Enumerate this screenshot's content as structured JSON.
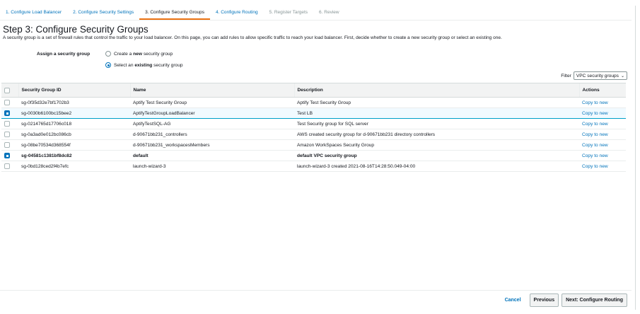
{
  "steps": [
    {
      "label": "1. Configure Load Balancer",
      "state": "link"
    },
    {
      "label": "2. Configure Security Settings",
      "state": "link"
    },
    {
      "label": "3. Configure Security Groups",
      "state": "active"
    },
    {
      "label": "4. Configure Routing",
      "state": "link"
    },
    {
      "label": "5. Register Targets",
      "state": "disabled"
    },
    {
      "label": "6. Review",
      "state": "disabled"
    }
  ],
  "page": {
    "title": "Step 3: Configure Security Groups",
    "description": "A security group is a set of firewall rules that control the traffic to your load balancer. On this page, you can add rules to allow specific traffic to reach your load balancer. First, decide whether to create a new security group or select an existing one."
  },
  "assign": {
    "label": "Assign a security group",
    "option_new": {
      "prefix": "Create a ",
      "bold": "new",
      "suffix": " security group",
      "checked": false
    },
    "option_existing": {
      "prefix": "Select an ",
      "bold": "existing",
      "suffix": " security group",
      "checked": true
    }
  },
  "filter": {
    "label": "Filter",
    "value": "VPC security groups"
  },
  "table": {
    "headers": [
      "Security Group ID",
      "Name",
      "Description",
      "Actions"
    ],
    "rows": [
      {
        "id": "sg-0f35d32e7bf1702b3",
        "name": "Aptify Test Security Group",
        "description": "Aptify Test Security Group",
        "action": "Copy to new",
        "checked": false
      },
      {
        "id": "sg-0030b6100bc15bee2",
        "name": "AptifyTestGroupLoadBalancer",
        "description": "Test LB",
        "action": "Copy to new",
        "checked": true
      },
      {
        "id": "sg-0214765d17706c018",
        "name": "AptifyTestSQL-AG",
        "description": "Test Security group for SQL server",
        "action": "Copy to new",
        "checked": false
      },
      {
        "id": "sg-0a3ad0e012bc086cb",
        "name": "d-90671bb231_controllers",
        "description": "AWS created security group for d-90671bb231 directory controllers",
        "action": "Copy to new",
        "checked": false
      },
      {
        "id": "sg-08be70534d368554f",
        "name": "d-90671bb231_workspacesMembers",
        "description": "Amazon WorkSpaces Security Group",
        "action": "Copy to new",
        "checked": false
      },
      {
        "id": "sg-04581c1381bf8dc82",
        "name": "default",
        "description": "default VPC security group",
        "action": "Copy to new",
        "checked": true
      },
      {
        "id": "sg-0bd128ced2f4b7efc",
        "name": "launch-wizard-3",
        "description": "launch-wizard-3 created 2021-08-16T14:28:50.049-04:00",
        "action": "Copy to new",
        "checked": false
      }
    ]
  },
  "footer": {
    "cancel": "Cancel",
    "previous": "Previous",
    "next": "Next: Configure Routing"
  },
  "colors": {
    "link": "#0073bb",
    "active_tab_underline": "#ec7211",
    "selected_row_bg": "#f1faff"
  }
}
